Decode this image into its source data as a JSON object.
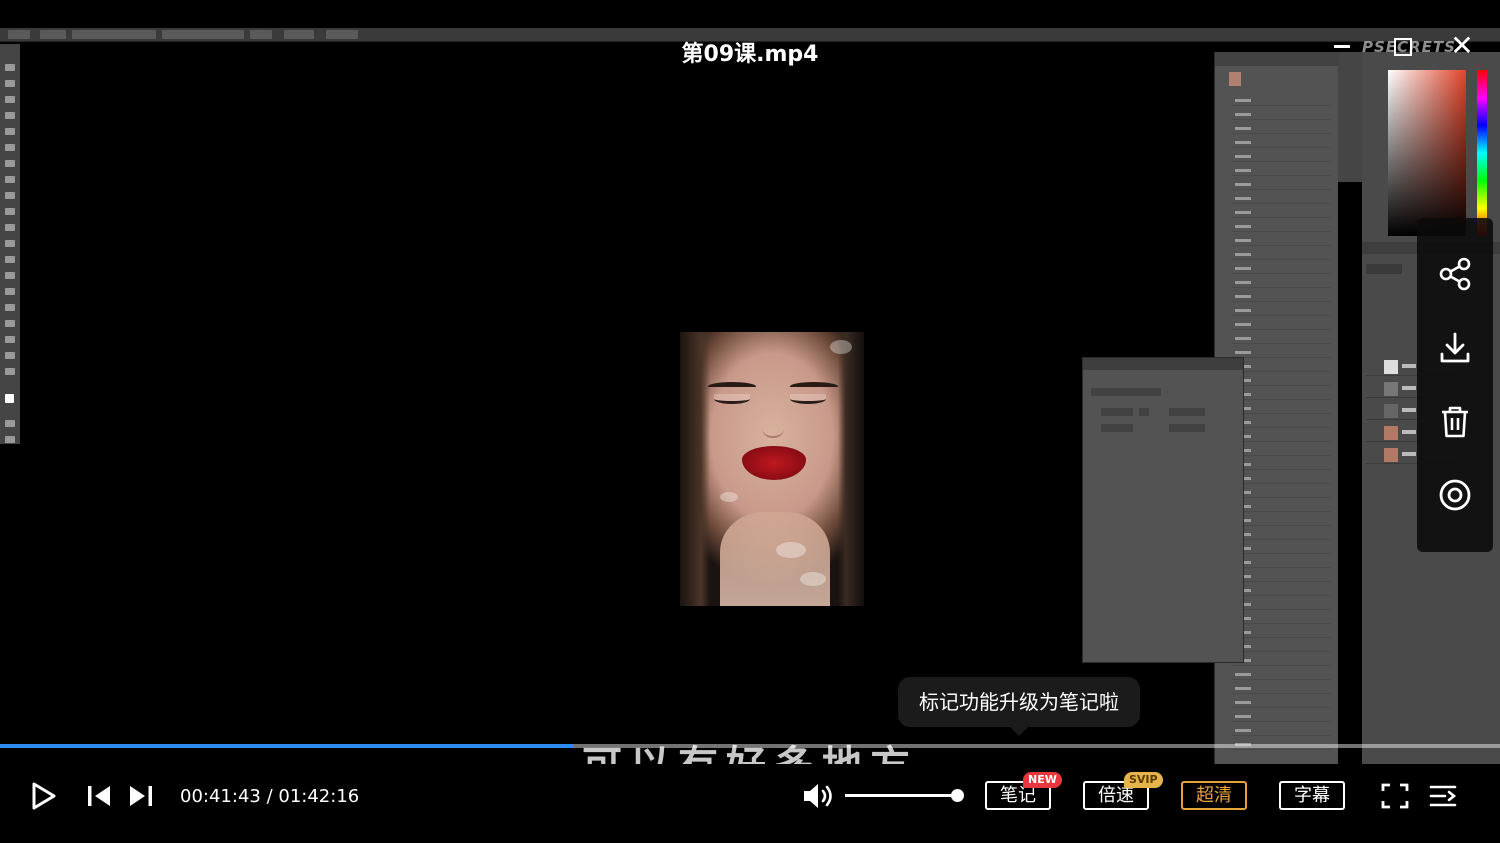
{
  "window": {
    "title": "第09课.mp4",
    "close_glyph": "✕"
  },
  "video": {
    "watermark": "PSECRETS"
  },
  "side_panel": {
    "items": [
      {
        "icon": "share-icon"
      },
      {
        "icon": "download-icon"
      },
      {
        "icon": "trash-icon"
      },
      {
        "icon": "record-icon"
      }
    ]
  },
  "tooltip": {
    "text": "标记功能升级为笔记啦"
  },
  "subtitle": {
    "text": "可以有好多地方"
  },
  "player": {
    "progress_fraction": 0.382,
    "current_time": "00:41:43",
    "separator": "/",
    "total_time": "01:42:16",
    "volume_fraction": 1.0,
    "buttons": {
      "notes": {
        "label": "笔记",
        "badge": "NEW"
      },
      "speed": {
        "label": "倍速",
        "badge": "SVIP"
      },
      "quality": {
        "label": "超清"
      },
      "captions": {
        "label": "字幕"
      }
    },
    "colors": {
      "progress": "#2c8cf0",
      "hd_accent": "#e6a33a",
      "new_badge": "#e8383d",
      "svip_badge": "#e5b54b"
    }
  }
}
